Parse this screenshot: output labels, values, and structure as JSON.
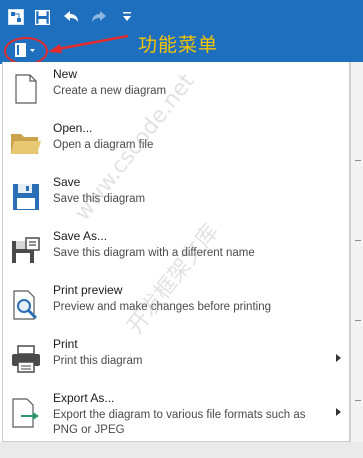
{
  "annotation": {
    "label": "功能菜单"
  },
  "watermark": {
    "line1": "www.cscode.net",
    "line2": "开发框架文库"
  },
  "quick_access": {
    "items": [
      {
        "icon": "app-icon"
      },
      {
        "icon": "save-icon"
      },
      {
        "icon": "undo-icon"
      },
      {
        "icon": "redo-icon"
      },
      {
        "icon": "customize-dropdown-icon"
      }
    ]
  },
  "app_button": {
    "icon": "app-menu-icon"
  },
  "menu": {
    "items": [
      {
        "title": "New",
        "description": "Create a new diagram",
        "icon": "new-document-icon",
        "has_submenu": false
      },
      {
        "title": "Open...",
        "description": "Open a diagram file",
        "icon": "folder-open-icon",
        "has_submenu": false
      },
      {
        "title": "Save",
        "description": "Save this diagram",
        "icon": "save-icon",
        "has_submenu": false
      },
      {
        "title": "Save As...",
        "description": "Save this diagram with a different name",
        "icon": "save-as-icon",
        "has_submenu": false
      },
      {
        "title": "Print preview",
        "description": "Preview and make changes before printing",
        "icon": "print-preview-icon",
        "has_submenu": false
      },
      {
        "title": "Print",
        "description": "Print this diagram",
        "icon": "printer-icon",
        "has_submenu": true
      },
      {
        "title": "Export As...",
        "description": "Export the diagram to various file formats such as PNG or JPEG",
        "icon": "export-icon",
        "has_submenu": true
      }
    ]
  },
  "colors": {
    "ribbon": "#1f6fbf",
    "annotation": "#f5c400",
    "highlight": "#e42c2c"
  }
}
